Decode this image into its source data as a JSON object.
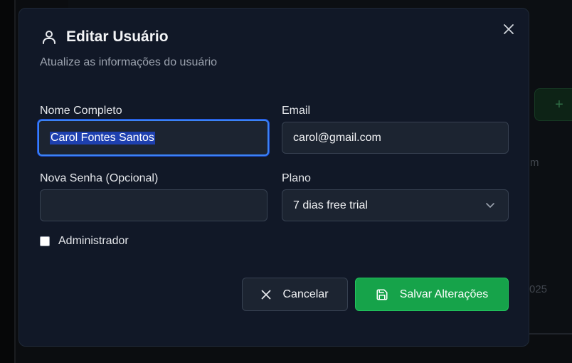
{
  "modal": {
    "title": "Editar Usuário",
    "subtitle": "Atualize as informações do usuário",
    "close_icon": "close-icon",
    "title_icon": "user-icon"
  },
  "form": {
    "full_name": {
      "label": "Nome Completo",
      "value": "Carol Fontes Santos",
      "text_selected": true
    },
    "email": {
      "label": "Email",
      "value": "carol@gmail.com"
    },
    "password": {
      "label": "Nova Senha (Opcional)",
      "value": ""
    },
    "plan": {
      "label": "Plano",
      "selected": "7 dias free trial",
      "icon": "chevron-down-icon"
    },
    "admin": {
      "label": "Administrador",
      "checked": false
    }
  },
  "actions": {
    "cancel_label": "Cancelar",
    "cancel_icon": "x-icon",
    "save_label": "Salvar Alterações",
    "save_icon": "save-icon"
  },
  "background": {
    "add_button_label": "+",
    "fragment_1": "m",
    "fragment_2": "025"
  },
  "colors": {
    "modal_bg": "#111827",
    "input_bg": "#1c2431",
    "focus_ring": "#3b82f6",
    "primary_green": "#16a34a"
  }
}
